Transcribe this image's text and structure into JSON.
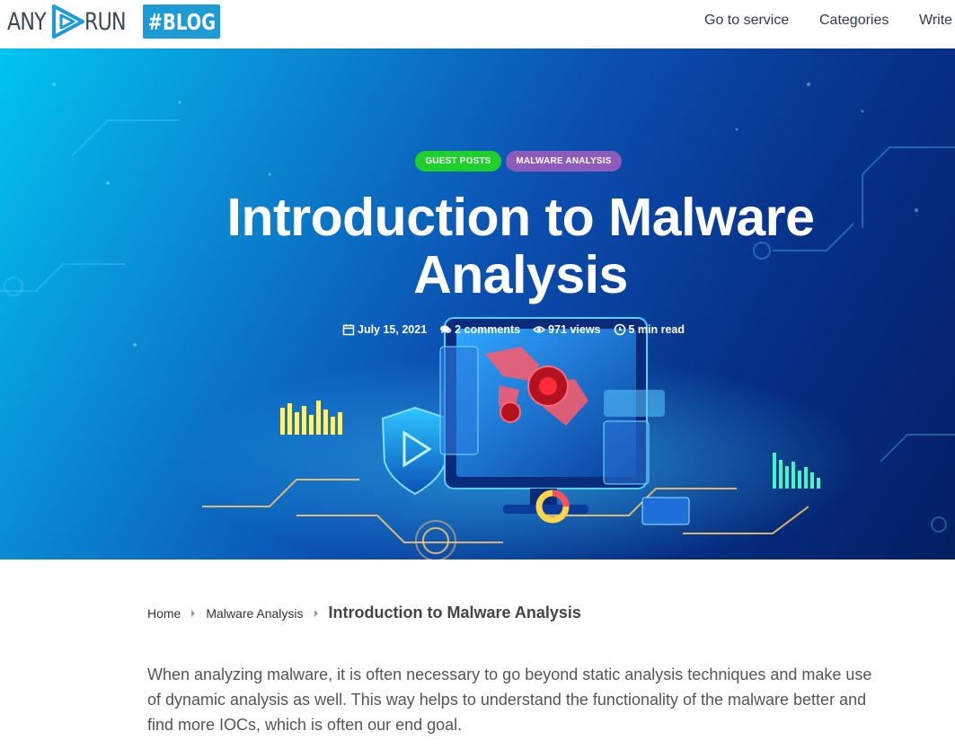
{
  "header": {
    "logo_left": "ANY",
    "logo_right": "RUN",
    "blog_badge": "#BLOG",
    "nav": [
      "Go to service",
      "Categories",
      "Write"
    ]
  },
  "hero": {
    "tags": [
      "GUEST POSTS",
      "MALWARE ANALYSIS"
    ],
    "title_line1": "Introduction to Malware",
    "title_line2": "Analysis",
    "meta": {
      "date": "July 15, 2021",
      "comments": "2 comments",
      "views": "971 views",
      "read_time": "5 min read"
    }
  },
  "breadcrumb": {
    "home": "Home",
    "category": "Malware Analysis",
    "current": "Introduction to Malware Analysis"
  },
  "article": {
    "intro": "When analyzing malware, it is often necessary to go beyond static analysis techniques and make use of dynamic analysis as well. This way helps to understand the functionality of the malware better and find more IOCs, which is often our end goal."
  },
  "colors": {
    "blog_badge": "#1d9bd6",
    "tag_guest": "#1fcf2a",
    "tag_malware": "#8d5bb9",
    "hero_start": "#00c4f0",
    "hero_end": "#041f63"
  },
  "icons": {
    "logo": "play-triangle-icon",
    "date": "calendar-icon",
    "comments": "comment-bubble-icon",
    "views": "eye-icon",
    "read_time": "clock-icon"
  }
}
